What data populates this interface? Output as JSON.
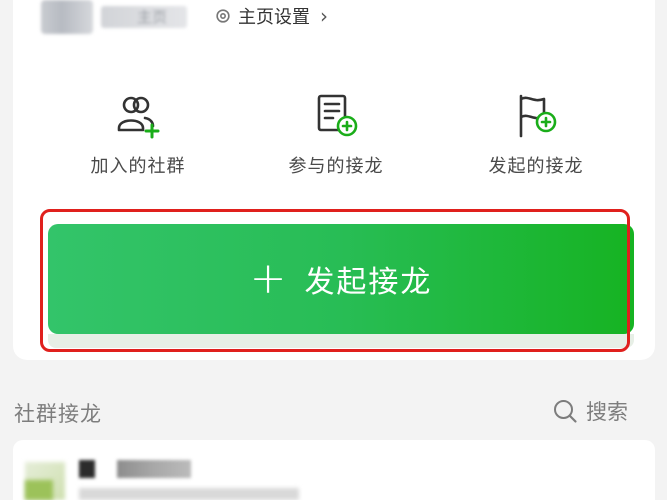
{
  "header": {
    "name_fragment": "主页",
    "settings_label": "主页设置",
    "chevron": "›"
  },
  "actions": [
    {
      "label": "加入的社群",
      "icon": "joined-group-icon"
    },
    {
      "label": "参与的接龙",
      "icon": "participated-list-icon"
    },
    {
      "label": "发起的接龙",
      "icon": "started-flag-icon"
    }
  ],
  "start_button": {
    "plus": "+",
    "label": "发起接龙"
  },
  "section": {
    "title": "社群接龙",
    "search_label": "搜索"
  },
  "colors": {
    "accent_green": "#1aad19",
    "button_green": "#28bd55",
    "highlight_red": "#e0201d"
  }
}
